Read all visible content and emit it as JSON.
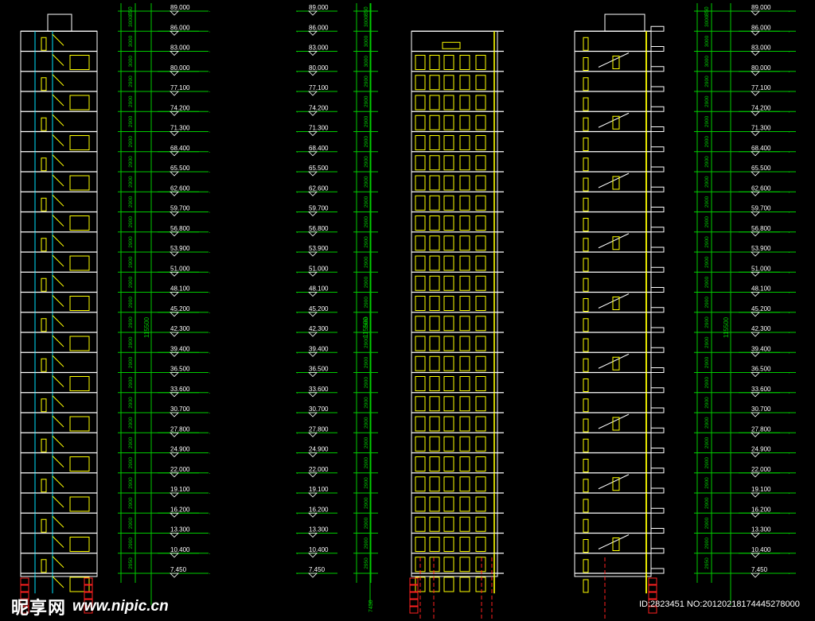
{
  "levels": [
    "89.000",
    "86.000",
    "83.000",
    "80.000",
    "77.100",
    "74.200",
    "71.300",
    "68.400",
    "65.500",
    "62.600",
    "59.700",
    "56.800",
    "53.900",
    "51.000",
    "48.100",
    "45.200",
    "42.300",
    "39.400",
    "36.500",
    "33.600",
    "30.700",
    "27.800",
    "24.900",
    "22.000",
    "19.100",
    "16.200",
    "13.300",
    "10.400",
    "7.450"
  ],
  "floor_dims": [
    "3000",
    "3000",
    "3000",
    "2900",
    "2900",
    "2900",
    "2900",
    "2900",
    "2900",
    "2900",
    "2900",
    "2900",
    "2900",
    "2900",
    "2900",
    "2900",
    "2900",
    "2900",
    "2900",
    "2900",
    "2900",
    "2900",
    "2900",
    "2900",
    "2900",
    "2900",
    "2900",
    "2950",
    "2950"
  ],
  "top_dim": "850",
  "total_dim": "115500",
  "base_dim": "7450",
  "watermark": {
    "cn": "昵享网",
    "url": "www.nipic.cn",
    "id_line": "ID:2823451 NO:20120218174445278000"
  },
  "colors": {
    "background": "#000000",
    "outline": "#ffffff",
    "dimension": "#00cc00",
    "section_fill": "#ffff00",
    "stair": "#00e5ff",
    "grid_red": "#ff2020"
  }
}
